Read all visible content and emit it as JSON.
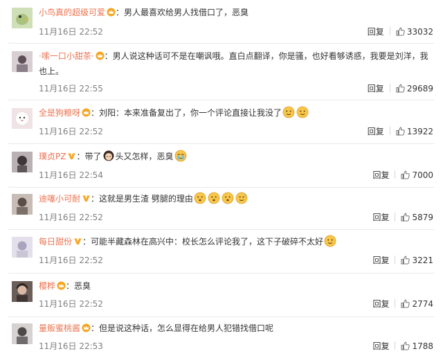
{
  "comments": [
    {
      "user": "小鸟真的超级可爱",
      "badge": "crown",
      "text": "男人最喜欢给男人找借口了，恶臭",
      "time": "11月16日 22:52",
      "reply_label": "回复",
      "likes": "33032",
      "avatar_color": "#b7c99a"
    },
    {
      "user": "·嗦一口小甜茶·",
      "badge": "crown",
      "text_line1": "男人说这种话可不是在嘲讽哦。直白点翻译，你是骚，也好看够诱惑，我要是刘洋，我",
      "text_line2": "也上。",
      "time": "11月16日 22:55",
      "reply_label": "回复",
      "likes": "29689",
      "avatar_color": "#8a7e86"
    },
    {
      "user": "全是狗粮呀",
      "badge": "crown",
      "text": "刘阳：本来准备复出了，你一个评论直接让我没了",
      "time": "11月16日 22:52",
      "reply_label": "回复",
      "likes": "13922",
      "avatar_color": "#e6d4d6"
    },
    {
      "user": "璞贞PZ",
      "badge": "v",
      "text_before": "带了",
      "text_after": "头又怎样，恶臭",
      "time": "11月16日 22:54",
      "reply_label": "回复",
      "likes": "7000",
      "avatar_color": "#5d5557"
    },
    {
      "user": "迪噻小可耐",
      "badge": "v",
      "text": "这就是男生渣 劈腿的理由",
      "time": "11月16日 22:52",
      "reply_label": "回复",
      "likes": "5879",
      "avatar_color": "#7c6f6a"
    },
    {
      "user": "每日甜份",
      "badge": "v",
      "text": "可能半藏森林在高兴中：校长怎么评论我了，这下子破碎不太好",
      "time": "11月16日 22:52",
      "reply_label": "回复",
      "likes": "3221",
      "avatar_color": "#c9c6d6"
    },
    {
      "user": "樱桦",
      "badge": "crown",
      "text": "恶臭",
      "time": "11月16日 22:52",
      "reply_label": "回复",
      "likes": "2774",
      "avatar_color": "#3f3533"
    },
    {
      "user": "量贩蜜桃酱",
      "badge": "crown",
      "text": "但是说这种话，怎么显得在给男人犯错找借口呢",
      "time": "11月16日 22:53",
      "reply_label": "回复",
      "likes": "1788",
      "avatar_color": "#6f6a6b"
    }
  ],
  "colors": {
    "username": "#eb7350",
    "text": "#333333",
    "meta": "#808080",
    "badge_crown": "#f5a623",
    "badge_v": "#f6a623",
    "emoji": "#f7c64a"
  },
  "icons": {
    "like": "thumbs-up-icon",
    "crown_badge": "crown-badge-icon",
    "v_badge": "v-badge-icon",
    "emoji_face": "emoji-face-icon",
    "emoji_girl": "emoji-girl-hair-icon",
    "emoji_cry": "emoji-crying-icon"
  }
}
